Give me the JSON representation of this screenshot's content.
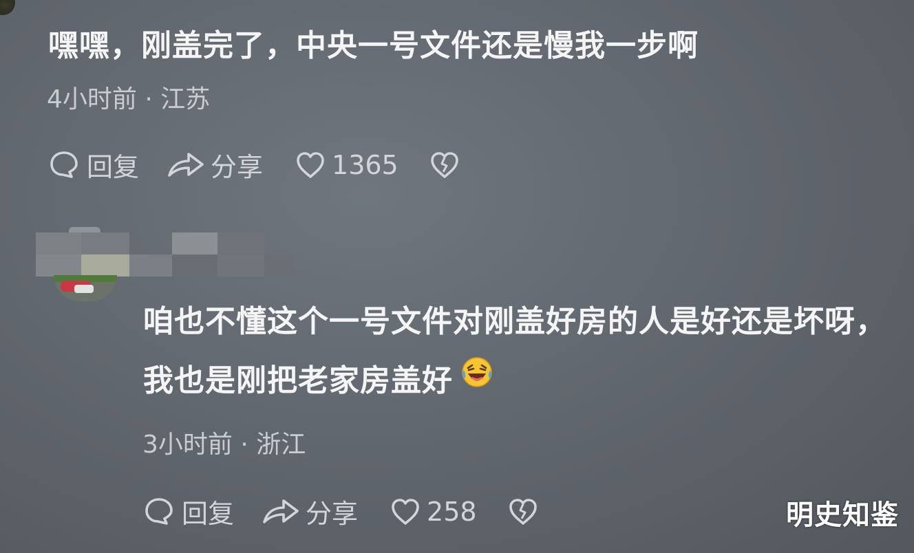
{
  "comments": [
    {
      "text": "嘿嘿，刚盖完了，中央一号文件还是慢我一步啊",
      "meta": "4小时前 · 江苏",
      "actions": {
        "reply_label": "回复",
        "share_label": "分享",
        "like_count": "1365"
      }
    },
    {
      "text": "咱也不懂这个一号文件对刚盖好房的人是好还是坏呀，我也是刚把老家房盖好",
      "emoji": "laughing-crying-emoji",
      "meta": "3小时前 · 浙江",
      "actions": {
        "reply_label": "回复",
        "share_label": "分享",
        "like_count": "258"
      }
    }
  ],
  "watermark": "明史知鉴",
  "colors": {
    "background": "#62686f",
    "text": "#f5f5f5",
    "meta": "#c9ccd0",
    "icon": "#d2d5d9"
  }
}
